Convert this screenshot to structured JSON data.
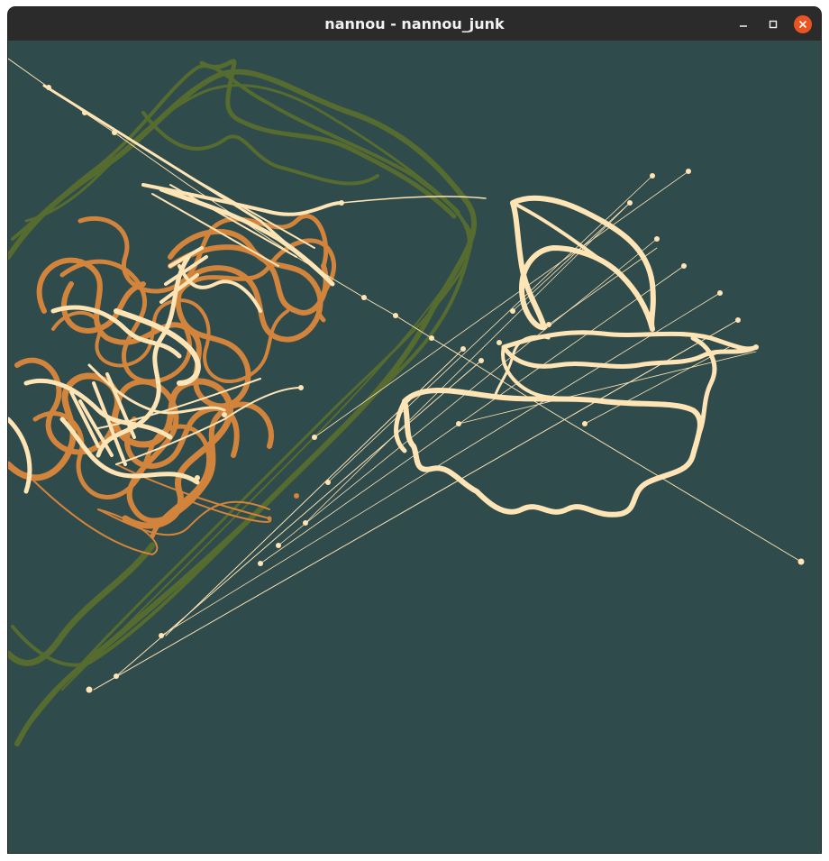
{
  "window": {
    "title": "nannou - nannou_junk",
    "controls": {
      "minimize_icon": "minimize-icon",
      "maximize_icon": "maximize-icon",
      "close_icon": "close-icon"
    }
  },
  "canvas": {
    "background_color": "#2f4b4b",
    "palette": {
      "olive": "#556b2f",
      "orange": "#d2843c",
      "cream": "#ffe4b5"
    }
  },
  "colors": {
    "titlebar": "#2b2b2b",
    "close_button": "#e95420"
  }
}
